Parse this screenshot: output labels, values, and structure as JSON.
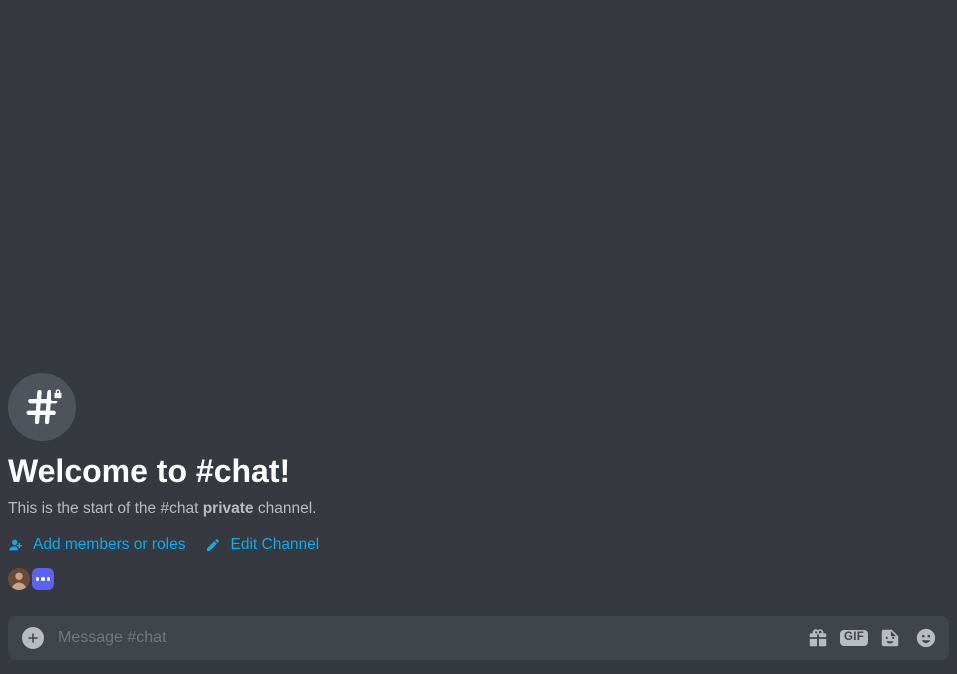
{
  "channel": {
    "name": "chat",
    "is_private": true
  },
  "welcome": {
    "title": "Welcome to #chat!",
    "sub_prefix": "This is the start of the #chat ",
    "sub_bold": "private",
    "sub_suffix": " channel."
  },
  "actions": {
    "add_members": "Add members or roles",
    "edit_channel": "Edit Channel"
  },
  "composer": {
    "placeholder": "Message #chat",
    "gif_label": "GIF"
  },
  "colors": {
    "bg": "#36393f",
    "composer": "#40444b",
    "accent_link": "#00aff4",
    "blurple": "#5865f2",
    "icon_muted": "#b9bbbe"
  }
}
